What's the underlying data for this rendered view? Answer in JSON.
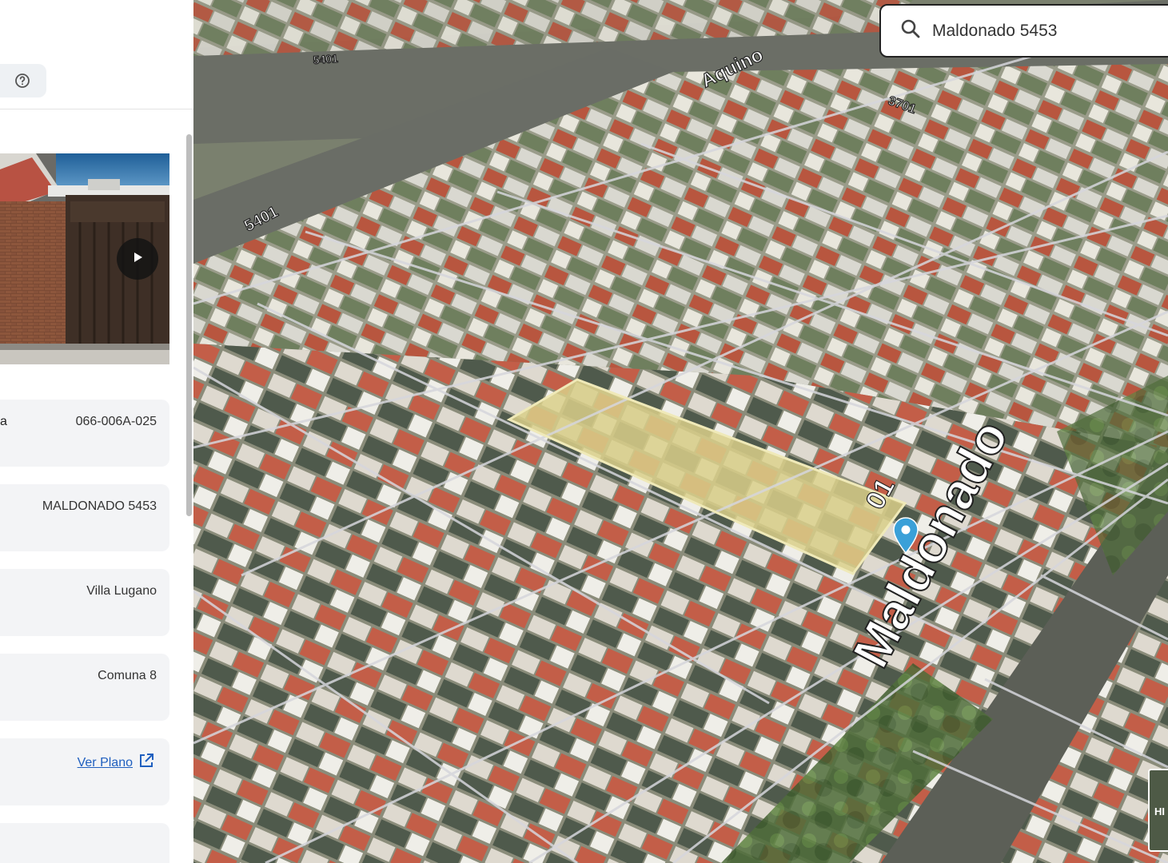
{
  "panel": {
    "help_icon": "help-circle-icon",
    "photo": {
      "play_icon": "play-icon"
    },
    "cards": [
      {
        "label_fragment": "a",
        "value": "066-006A-025"
      },
      {
        "label_fragment": "",
        "value": "MALDONADO 5453"
      },
      {
        "label_fragment": "",
        "value": "Villa Lugano"
      },
      {
        "label_fragment": "",
        "value": "Comuna 8"
      },
      {
        "label_fragment": "",
        "link_text": "Ver Plano",
        "link_icon": "external-link-icon"
      }
    ]
  },
  "search": {
    "value": "Maldonado 5453",
    "icon": "search-icon"
  },
  "map": {
    "street_labels": {
      "aquino": "Aquino",
      "maldonado": "Maldonado",
      "number_5401_top": "5401",
      "number_5401_left": "5401",
      "number_3701": "3701",
      "number_partial": "01"
    },
    "marker_icon": "map-pin-icon",
    "basemap_toggle_label": "HI",
    "highlight_color": "#d9cf8a",
    "marker_color": "#3aa0d8"
  }
}
